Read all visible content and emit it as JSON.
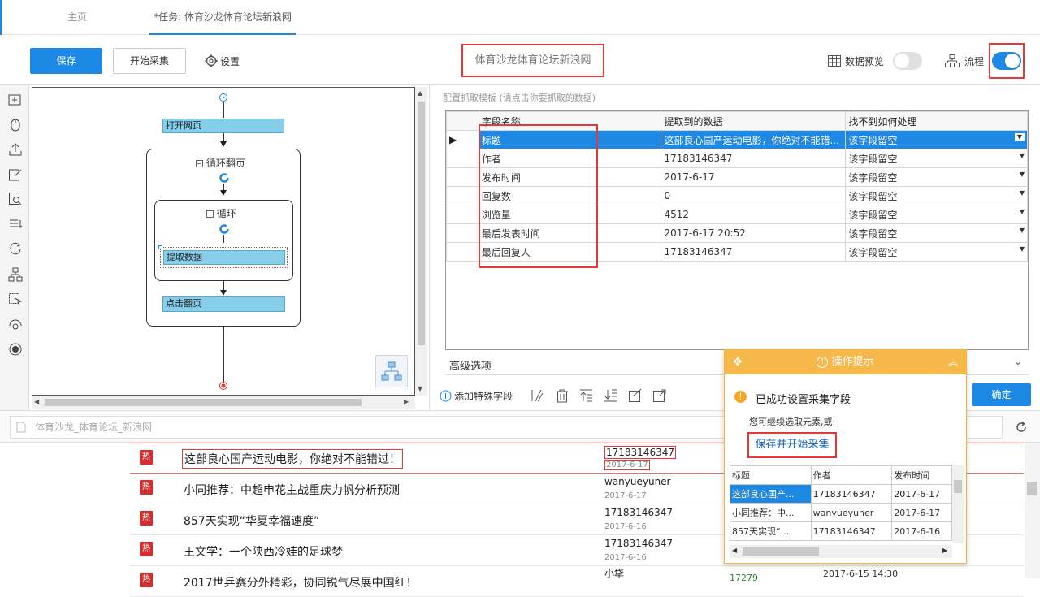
{
  "tabs": [
    {
      "label": "主页"
    },
    {
      "label": "*任务: 体育沙龙体育论坛新浪网"
    }
  ],
  "toolbar": {
    "save_label": "保存",
    "start_label": "开始采集",
    "settings_label": "设置",
    "task_title": "体育沙龙体育论坛新浪网",
    "data_preview_label": "数据预览",
    "data_preview_on": false,
    "flow_label": "流程",
    "flow_on": true
  },
  "flow": {
    "open_page": "打开网页",
    "loop_page": "循环翻页",
    "loop": "循环",
    "extract": "提取数据",
    "click_next": "点击翻页"
  },
  "config": {
    "caption": "配置抓取模板 (请点击你要抓取的数据)",
    "headers": [
      "字段名称",
      "提取到的数据",
      "找不到如何处理"
    ],
    "rows": [
      {
        "field": "标题",
        "value": "这部良心国产运动电影，你绝对不能错...",
        "handle": "该字段留空",
        "selected": true
      },
      {
        "field": "作者",
        "value": "17183146347",
        "handle": "该字段留空"
      },
      {
        "field": "发布时间",
        "value": "2017-6-17",
        "handle": "该字段留空"
      },
      {
        "field": "回复数",
        "value": "0",
        "handle": "该字段留空"
      },
      {
        "field": "浏览量",
        "value": "4512",
        "handle": "该字段留空"
      },
      {
        "field": "最后发表时间",
        "value": "2017-6-17 20:52",
        "handle": "该字段留空"
      },
      {
        "field": "最后回复人",
        "value": "17183146347",
        "handle": "该字段留空"
      }
    ],
    "advanced_label": "高级选项",
    "add_field_label": "添加特殊字段",
    "confirm_label": "确定"
  },
  "browser": {
    "url_text": "体育沙龙_体育论坛_新浪网"
  },
  "page_rows": [
    {
      "badge": "热",
      "title": "这部良心国产运动电影，你绝对不能错过！",
      "author": "17183146347",
      "date": "2017-6-17",
      "highlight": true
    },
    {
      "badge": "热",
      "title": "小同推荐：中超申花主战重庆力帆分析预测",
      "author": "wanyueyuner",
      "date": "2017-6-17"
    },
    {
      "badge": "热",
      "title": "857天实现“华夏幸福速度”",
      "author": "17183146347",
      "date": "2017-6-16"
    },
    {
      "badge": "热",
      "title": "王文学：一个陕西冷娃的足球梦",
      "author": "17183146347",
      "date": "2017-6-16"
    },
    {
      "badge": "热",
      "title": "2017世乒赛分外精彩，协同锐气尽展中国红！",
      "author": "小牮",
      "date": "",
      "extra_count": "17279",
      "extra_time": "2017-6-15 14:30"
    }
  ],
  "popup": {
    "title": "操作提示",
    "success": "已成功设置采集字段",
    "hint": "您可继续选取元素,或:",
    "save_start": "保存并开始采集",
    "headers": [
      "标题",
      "作者",
      "发布时间"
    ],
    "rows": [
      [
        "这部良心国产...",
        "17183146347",
        "2017-6-17"
      ],
      [
        "小同推荐：中...",
        "wanyueyuner",
        "2017-6-17"
      ],
      [
        "857天实现“...",
        "17183146347",
        "2017-6-16"
      ]
    ]
  },
  "colors": {
    "accent": "#1e88e5",
    "node": "#87ceeb",
    "highlight_red": "#e53935",
    "popup_orange": "#f7b84b"
  }
}
